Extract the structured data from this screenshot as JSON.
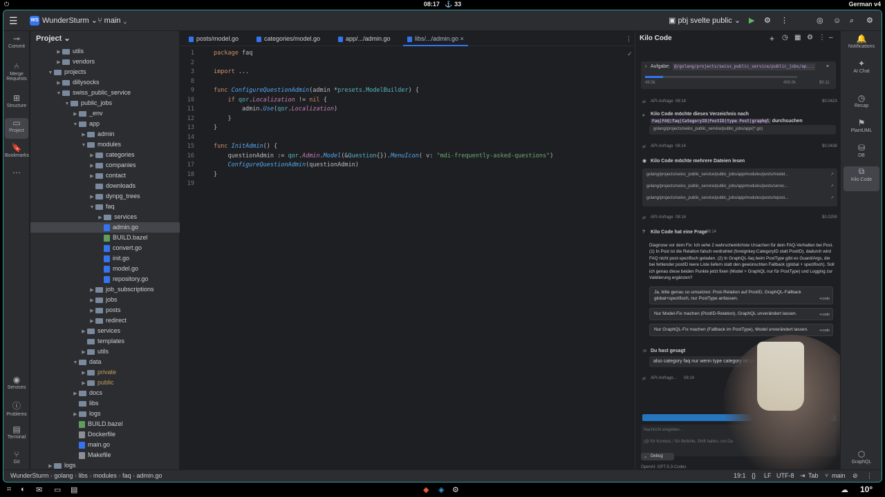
{
  "topbar": {
    "time": "08:17",
    "count": "33",
    "keyboard": "German v4"
  },
  "titlebar": {
    "project_badge": "WS",
    "project": "WunderSturm",
    "branch": "main",
    "run_config": "pbj svelte public"
  },
  "left_tools": [
    {
      "label": "Commit",
      "icon": "commit-icon"
    },
    {
      "label": "Merge Requests",
      "icon": "merge-request-icon"
    },
    {
      "label": "Structure",
      "icon": "structure-icon"
    },
    {
      "label": "Project",
      "icon": "folder-icon"
    },
    {
      "label": "Bookmarks",
      "icon": "bookmark-icon"
    },
    {
      "label": "Services",
      "icon": "services-icon"
    },
    {
      "label": "Problems",
      "icon": "problems-icon"
    },
    {
      "label": "Terminal",
      "icon": "terminal-icon"
    },
    {
      "label": "Git",
      "icon": "git-icon"
    }
  ],
  "right_tools": [
    {
      "label": "Notifications",
      "icon": "bell-icon"
    },
    {
      "label": "AI Chat",
      "icon": "ai-chat-icon"
    },
    {
      "label": "Recap",
      "icon": "recap-icon"
    },
    {
      "label": "PlantUML",
      "icon": "plantuml-icon"
    },
    {
      "label": "DB",
      "icon": "database-icon"
    },
    {
      "label": "Kilo Code",
      "icon": "kilo-icon"
    },
    {
      "label": "GraphQL",
      "icon": "graphql-icon"
    }
  ],
  "project_panel": {
    "title": "Project",
    "tree": [
      {
        "name": "utils",
        "kind": "folder",
        "indent": 3,
        "arrow": "▶"
      },
      {
        "name": "vendors",
        "kind": "folder",
        "indent": 3,
        "arrow": "▶"
      },
      {
        "name": "projects",
        "kind": "folder",
        "indent": 2,
        "arrow": "▼"
      },
      {
        "name": "dillysocks",
        "kind": "folder",
        "indent": 3,
        "arrow": "▶"
      },
      {
        "name": "swiss_public_service",
        "kind": "folder",
        "indent": 3,
        "arrow": "▼"
      },
      {
        "name": "public_jobs",
        "kind": "folder",
        "indent": 4,
        "arrow": "▼"
      },
      {
        "name": "_env",
        "kind": "folder",
        "indent": 5,
        "arrow": "▶"
      },
      {
        "name": "app",
        "kind": "folder",
        "indent": 5,
        "arrow": "▼"
      },
      {
        "name": "admin",
        "kind": "folder",
        "indent": 6,
        "arrow": "▶"
      },
      {
        "name": "modules",
        "kind": "folder",
        "indent": 6,
        "arrow": "▼"
      },
      {
        "name": "categories",
        "kind": "folder",
        "indent": 7,
        "arrow": "▶"
      },
      {
        "name": "companies",
        "kind": "folder",
        "indent": 7,
        "arrow": "▶"
      },
      {
        "name": "contact",
        "kind": "folder",
        "indent": 7,
        "arrow": "▶"
      },
      {
        "name": "downloads",
        "kind": "folder",
        "indent": 7,
        "arrow": ""
      },
      {
        "name": "dynpg_trees",
        "kind": "folder",
        "indent": 7,
        "arrow": "▶"
      },
      {
        "name": "faq",
        "kind": "folder",
        "indent": 7,
        "arrow": "▼"
      },
      {
        "name": "services",
        "kind": "folder",
        "indent": 8,
        "arrow": "▶"
      },
      {
        "name": "admin.go",
        "kind": "go",
        "indent": 8,
        "arrow": "",
        "selected": true
      },
      {
        "name": "BUILD.bazel",
        "kind": "bazel",
        "indent": 8,
        "arrow": ""
      },
      {
        "name": "convert.go",
        "kind": "go",
        "indent": 8,
        "arrow": ""
      },
      {
        "name": "init.go",
        "kind": "go",
        "indent": 8,
        "arrow": ""
      },
      {
        "name": "model.go",
        "kind": "go",
        "indent": 8,
        "arrow": ""
      },
      {
        "name": "repository.go",
        "kind": "go",
        "indent": 8,
        "arrow": ""
      },
      {
        "name": "job_subscriptions",
        "kind": "folder",
        "indent": 7,
        "arrow": "▶"
      },
      {
        "name": "jobs",
        "kind": "folder",
        "indent": 7,
        "arrow": "▶"
      },
      {
        "name": "posts",
        "kind": "folder",
        "indent": 7,
        "arrow": "▶"
      },
      {
        "name": "redirect",
        "kind": "folder",
        "indent": 7,
        "arrow": "▶"
      },
      {
        "name": "services",
        "kind": "folder",
        "indent": 6,
        "arrow": "▶"
      },
      {
        "name": "templates",
        "kind": "folder",
        "indent": 6,
        "arrow": ""
      },
      {
        "name": "utils",
        "kind": "folder",
        "indent": 6,
        "arrow": "▶"
      },
      {
        "name": "data",
        "kind": "folder",
        "indent": 5,
        "arrow": "▼"
      },
      {
        "name": "private",
        "kind": "folder",
        "indent": 6,
        "arrow": "▶",
        "muted": true
      },
      {
        "name": "public",
        "kind": "folder",
        "indent": 6,
        "arrow": "▶",
        "muted": true
      },
      {
        "name": "docs",
        "kind": "folder",
        "indent": 5,
        "arrow": "▶"
      },
      {
        "name": "libs",
        "kind": "folder",
        "indent": 5,
        "arrow": ""
      },
      {
        "name": "logs",
        "kind": "folder",
        "indent": 5,
        "arrow": "▶"
      },
      {
        "name": "BUILD.bazel",
        "kind": "bazel",
        "indent": 5,
        "arrow": ""
      },
      {
        "name": "Dockerfile",
        "kind": "generic",
        "indent": 5,
        "arrow": ""
      },
      {
        "name": "main.go",
        "kind": "go",
        "indent": 5,
        "arrow": ""
      },
      {
        "name": "Makefile",
        "kind": "generic",
        "indent": 5,
        "arrow": ""
      },
      {
        "name": "logs",
        "kind": "folder",
        "indent": 2,
        "arrow": "▶"
      }
    ]
  },
  "editor": {
    "tabs": [
      {
        "label": "posts/model.go",
        "active": false
      },
      {
        "label": "categories/model.go",
        "active": false
      },
      {
        "label": "app/.../admin.go",
        "active": false
      },
      {
        "label": "libs/.../admin.go",
        "active": true
      }
    ],
    "lines": [
      {
        "n": "1",
        "tokens": [
          [
            "k",
            "package "
          ],
          [
            "d",
            "faq"
          ]
        ]
      },
      {
        "n": "2",
        "tokens": []
      },
      {
        "n": "3",
        "tokens": [
          [
            "k",
            "import "
          ],
          [
            "d",
            "..."
          ]
        ]
      },
      {
        "n": "8",
        "tokens": []
      },
      {
        "n": "9",
        "tokens": [
          [
            "k",
            "func "
          ],
          [
            "fi",
            "ConfigureQuestionAdmin"
          ],
          [
            "d",
            "(admin *"
          ],
          [
            "t",
            "presets"
          ],
          [
            "d",
            "."
          ],
          [
            "t",
            "ModelBuilder"
          ],
          [
            "d",
            ") {"
          ]
        ]
      },
      {
        "n": "10",
        "tokens": [
          [
            "d",
            "    "
          ],
          [
            "k",
            "if "
          ],
          [
            "t",
            "qor"
          ],
          [
            "d",
            "."
          ],
          [
            "it",
            "Localization"
          ],
          [
            "d",
            " != "
          ],
          [
            "k",
            "nil"
          ],
          [
            "d",
            " {"
          ]
        ]
      },
      {
        "n": "11",
        "tokens": [
          [
            "d",
            "        admin."
          ],
          [
            "fi",
            "Use"
          ],
          [
            "d",
            "("
          ],
          [
            "t",
            "qor"
          ],
          [
            "d",
            "."
          ],
          [
            "it",
            "Localization"
          ],
          [
            "d",
            ")"
          ]
        ]
      },
      {
        "n": "12",
        "tokens": [
          [
            "d",
            "    }"
          ]
        ]
      },
      {
        "n": "13",
        "tokens": [
          [
            "d",
            "}"
          ]
        ]
      },
      {
        "n": "14",
        "tokens": []
      },
      {
        "n": "15",
        "tokens": [
          [
            "k",
            "func "
          ],
          [
            "fi",
            "InitAdmin"
          ],
          [
            "d",
            "() {"
          ]
        ]
      },
      {
        "n": "16",
        "tokens": [
          [
            "d",
            "    questionAdmin := "
          ],
          [
            "t",
            "qor"
          ],
          [
            "d",
            "."
          ],
          [
            "it",
            "Admin"
          ],
          [
            "d",
            "."
          ],
          [
            "fi",
            "Model"
          ],
          [
            "d",
            "(&"
          ],
          [
            "t",
            "Question"
          ],
          [
            "d",
            "{})."
          ],
          [
            "fi",
            "MenuIcon"
          ],
          [
            "d",
            "( v: "
          ],
          [
            "s",
            "\"mdi-frequently-asked-questions\""
          ],
          [
            "d",
            ")"
          ]
        ]
      },
      {
        "n": "17",
        "tokens": [
          [
            "d",
            "    "
          ],
          [
            "fi",
            "ConfigureQuestionAdmin"
          ],
          [
            "d",
            "(questionAdmin)"
          ]
        ]
      },
      {
        "n": "18",
        "tokens": [
          [
            "d",
            "}"
          ]
        ]
      },
      {
        "n": "19",
        "tokens": []
      }
    ]
  },
  "kilo": {
    "title": "Kilo Code",
    "task_label": "Aufgabe:",
    "task_path": "@/golang/projects/swiss_public_service/public_jobs/ap...",
    "tokens_left": "49.5k",
    "tokens_right": "400.0k",
    "cost": "$0.11",
    "api1": {
      "label": "API-Anfrage",
      "time": "08:14",
      "cost": "$0.0423"
    },
    "search_title": "Kilo Code möchte dieses Verzeichnis nach",
    "search_pattern": "Faq|FAQ|faq|CategoryID|PostID|type Post|graphql",
    "search_suffix": "durchsuchen",
    "search_path": "golang/projects/swiss_public_service/public_jobs/app/(*.go)",
    "api2": {
      "label": "API-Anfrage",
      "time": "08:14",
      "cost": "$0.0438"
    },
    "read_title": "Kilo Code möchte mehrere Dateien lesen",
    "files": [
      "golang/projects/swiss_public_service/public_jobs/app/modules/posts/model...",
      "golang/projects/swiss_public_service/public_jobs/app/modules/posts/servic...",
      "golang/projects/swiss_public_service/public_jobs/app/modules/posts/reposi..."
    ],
    "api3": {
      "label": "API-Anfrage",
      "time": "08:14",
      "cost": "$0.0259"
    },
    "question_title": "Kilo Code hat eine Frage",
    "question_time": "08:14",
    "question_text": "Diagnose vor dem Fix: Ich sehe 2 wahrscheinlichste Ursachen für dein FAQ-Verhalten bei Post. (1) In Post ist die Relation falsch verdrahtet (foreignkey:CategoryID statt PostID), dadurch wird FAQ nicht post-spezifisch geladen. (2) In GraphQL-faq beim PostType gibt es Guard/Args, die bei fehlender postID leere Liste liefern statt den gewünschten Fallback (global + spezifisch). Soll ich genau diese beiden Punkte jetzt fixen (Model + GraphQL nur für PostType) und Logging zur Validierung ergänzen?",
    "options": [
      {
        "text": "Ja, bitte genau so umsetzen: Post-Relation auf PostID, GraphQL-Fallback global+spezifisch, nur PostType anfassen.",
        "tag": "+code"
      },
      {
        "text": "Nur Model-Fix machen (PostID-Relation), GraphQL unverändert lassen.",
        "tag": "+code"
      },
      {
        "text": "Nur GraphQL-Fix machen (Fallback im PostType), Model unverändert lassen.",
        "tag": "+code"
      }
    ],
    "user_title": "Du hast gesagt",
    "user_text": "also category faq nur wenn type category ist und",
    "api4": {
      "label": "API-Anfrage...",
      "time": "08:14"
    },
    "input_placeholder": "Nachricht eingeben...",
    "input_hint": "(@ für Kontext, / für Befehle, Shift halten, um Da",
    "mode": "Debug",
    "model": "OpenAI: GPT-5.3-Codex"
  },
  "statusbar": {
    "crumbs": [
      "WunderSturm",
      "golang",
      "libs",
      "modules",
      "faq",
      "admin.go"
    ],
    "position": "19:1",
    "line_ending": "LF",
    "encoding": "UTF-8",
    "indent": "Tab",
    "branch": "main"
  },
  "taskbar": {
    "weather": "10°"
  },
  "colors": {
    "accent": "#3574f0",
    "border": "#2f9aa0",
    "bg": "#1e1f22",
    "panel": "#2b2d30"
  }
}
